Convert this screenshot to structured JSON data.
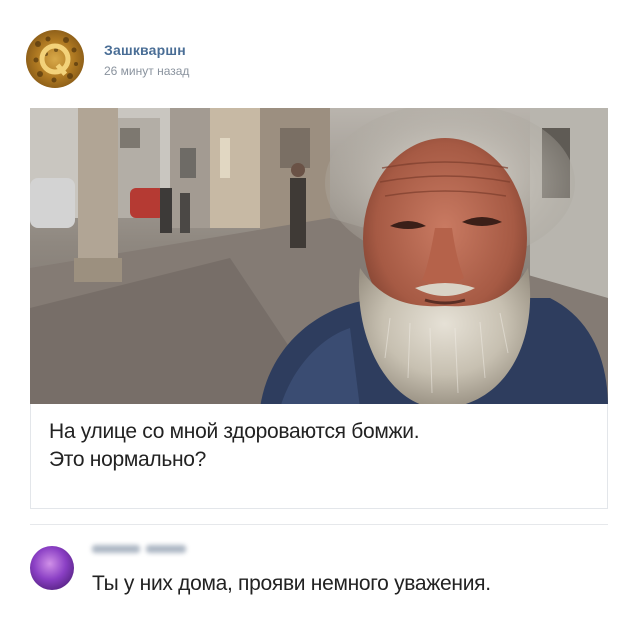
{
  "post": {
    "author": "Зашкваршн",
    "time": "26 минут назад",
    "caption_line1": "На улице со мной здороваются бомжи.",
    "caption_line2": "Это нормально?"
  },
  "comment": {
    "text": "Ты у них дома, прояви немного уважения."
  },
  "colors": {
    "author_link": "#4a6e96",
    "meta_text": "#8a939e",
    "body_text": "#222222"
  },
  "icons": {
    "post_avatar": "community-avatar-icon",
    "comment_avatar": "user-avatar-icon"
  }
}
